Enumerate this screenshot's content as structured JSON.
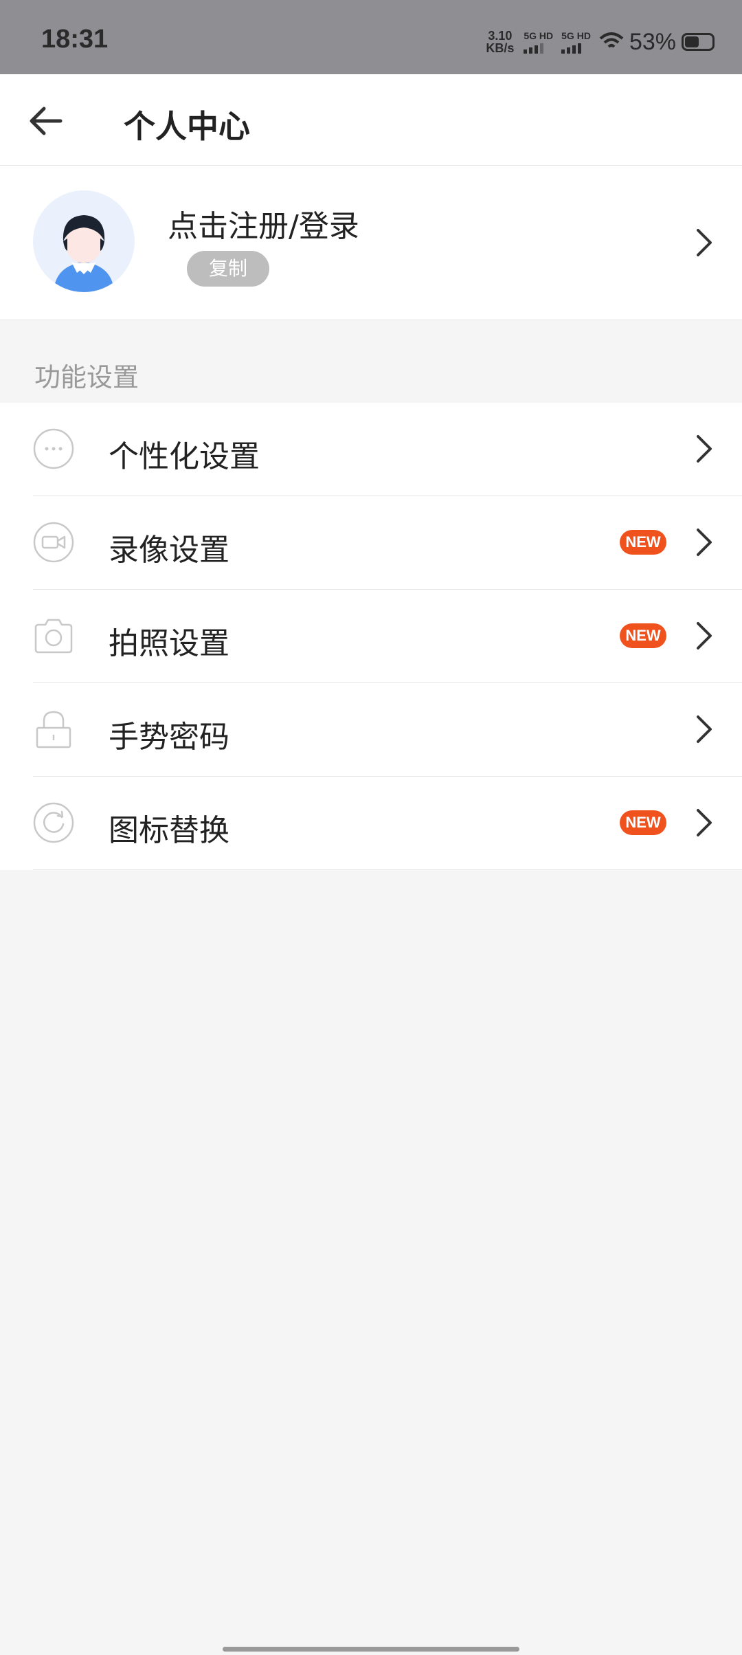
{
  "status_bar": {
    "time": "18:31",
    "net_speed_value": "3.10",
    "net_speed_unit": "KB/s",
    "sim1_label": "5G HD",
    "sim2_label": "5G HD",
    "battery_percent": "53%",
    "battery_level": 0.53
  },
  "header": {
    "title": "个人中心",
    "back_icon": "arrow-left-icon"
  },
  "profile": {
    "login_text": "点击注册/登录",
    "copy_label": "复制"
  },
  "section": {
    "title": "功能设置"
  },
  "menu": [
    {
      "label": "个性化设置",
      "icon": "more-dots-icon",
      "badge": ""
    },
    {
      "label": "录像设置",
      "icon": "video-camera-icon",
      "badge": "NEW"
    },
    {
      "label": "拍照设置",
      "icon": "camera-icon",
      "badge": "NEW"
    },
    {
      "label": "手势密码",
      "icon": "lock-icon",
      "badge": ""
    },
    {
      "label": "图标替换",
      "icon": "refresh-icon",
      "badge": "NEW"
    }
  ],
  "colors": {
    "badge": "#f0521e",
    "status_bar_bg": "#8e8e93",
    "avatar_bg": "#eaf0fc"
  }
}
